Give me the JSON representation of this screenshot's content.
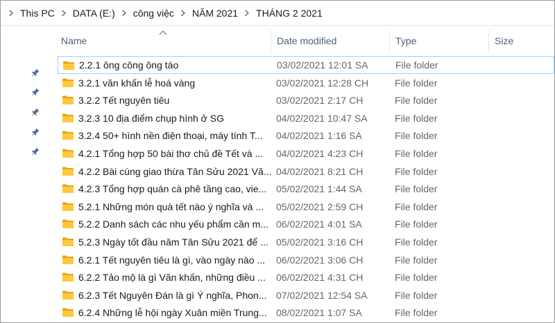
{
  "breadcrumb": [
    "This PC",
    "DATA (E:)",
    "công việc",
    "NĂM 2021",
    "THÁNG 2 2021"
  ],
  "columns": {
    "name": "Name",
    "date_modified": "Date modified",
    "type": "Type",
    "size": "Size"
  },
  "sort": {
    "column": "name",
    "direction": "ascending"
  },
  "colors": {
    "folder": "#ffc83d",
    "folder_dark": "#e8a317",
    "header_text": "#4c607a",
    "selection_border": "#99d1ff"
  },
  "nav_icons": [
    "pin-icon",
    "pin-icon",
    "pin-icon",
    "pin-icon",
    "pin-icon"
  ],
  "files": [
    {
      "name": "2.2.1 ông công ông táo",
      "date": "03/02/2021 12:01 SA",
      "type": "File folder"
    },
    {
      "name": "3.2.1 văn khấn lễ hoá vàng",
      "date": "03/02/2021 12:28 CH",
      "type": "File folder"
    },
    {
      "name": "3.2.2 Tết nguyên tiêu",
      "date": "03/02/2021 2:17 CH",
      "type": "File folder"
    },
    {
      "name": "3.2.3 10 địa điểm chụp hình ở SG",
      "date": "04/02/2021 10:47 SA",
      "type": "File folder"
    },
    {
      "name": "3.2.4 50+ hình nền điện thoại, máy tính T...",
      "date": "04/02/2021 1:16 SA",
      "type": "File folder"
    },
    {
      "name": "4.2.1 Tổng hợp 50 bài thơ chủ đề Tết và ...",
      "date": "04/02/2021 4:23 CH",
      "type": "File folder"
    },
    {
      "name": "4.2.2 Bài cúng giao thừa Tân Sửu 2021 Vă...",
      "date": "04/02/2021 8:21 CH",
      "type": "File folder"
    },
    {
      "name": "4.2.3 Tổng hợp quán cà phê tầng cao, vie...",
      "date": "05/02/2021 1:44 SA",
      "type": "File folder"
    },
    {
      "name": "5.2.1 Những món quà tết nào ý nghĩa và ...",
      "date": "05/02/2021 2:59 CH",
      "type": "File folder"
    },
    {
      "name": "5.2.2 Danh sách các nhu yếu phẩm cần m...",
      "date": "06/02/2021 4:01 SA",
      "type": "File folder"
    },
    {
      "name": "5.2.3 Ngày tốt đầu năm Tân Sửu 2021 để ...",
      "date": "05/02/2021 3:16 CH",
      "type": "File folder"
    },
    {
      "name": "6.2.1 Tết nguyên tiêu là gì, vào ngày nào ...",
      "date": "06/02/2021 3:06 CH",
      "type": "File folder"
    },
    {
      "name": "6.2.2 Tảo mộ là gì Văn khấn, những điều ...",
      "date": "06/02/2021 4:31 CH",
      "type": "File folder"
    },
    {
      "name": "6.2.3 Tết Nguyên Đán là gì Ý nghĩa, Phon...",
      "date": "07/02/2021 12:54 SA",
      "type": "File folder"
    },
    {
      "name": "6.2.4 Những lễ hội ngày Xuân miền Trung...",
      "date": "08/02/2021 1:07 SA",
      "type": "File folder"
    }
  ]
}
